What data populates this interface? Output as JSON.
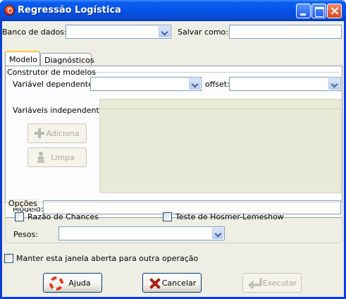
{
  "window": {
    "title": "Regressão Logística"
  },
  "top": {
    "dataset_label": "Banco de dados:",
    "dataset_value": "",
    "saveas_label": "Salvar como:",
    "saveas_value": ""
  },
  "tabs": [
    {
      "label": "Modelo",
      "active": true
    },
    {
      "label": "Diagnósticos",
      "active": false
    }
  ],
  "builder": {
    "group_title": "Construtor de modelos",
    "dependent_label": "Variável dependente:",
    "dependent_value": "",
    "offset_label": "offset:",
    "offset_value": "",
    "independent_label": "Variáveis independentes:",
    "add_label": "Adiciona",
    "clear_label": "Limpa",
    "model_label": "Modelo:",
    "model_value": ""
  },
  "options": {
    "group_title": "Opções",
    "odds_ratio_label": "Razão de Chances",
    "odds_ratio_checked": false,
    "hosmer_label": "Teste de Hosmer-Lemeshow",
    "hosmer_checked": false,
    "weights_label": "Pesos:",
    "weights_value": ""
  },
  "footer": {
    "keep_open_label": "Manter esta janela aberta para outra operação",
    "keep_open_checked": false,
    "help_label": "Ajuda",
    "cancel_label": "Cancelar",
    "run_label": "Executar"
  },
  "icons": {
    "app": "app-logo-icon",
    "add": "plus-icon",
    "clear": "broom-icon",
    "help": "lifebuoy-icon",
    "cancel": "red-x-icon",
    "run": "enter-arrow-icon"
  },
  "colors": {
    "titlebar": "#0553e6",
    "client_bg": "#eeeee4",
    "tab_highlight": "#ffc83c"
  }
}
